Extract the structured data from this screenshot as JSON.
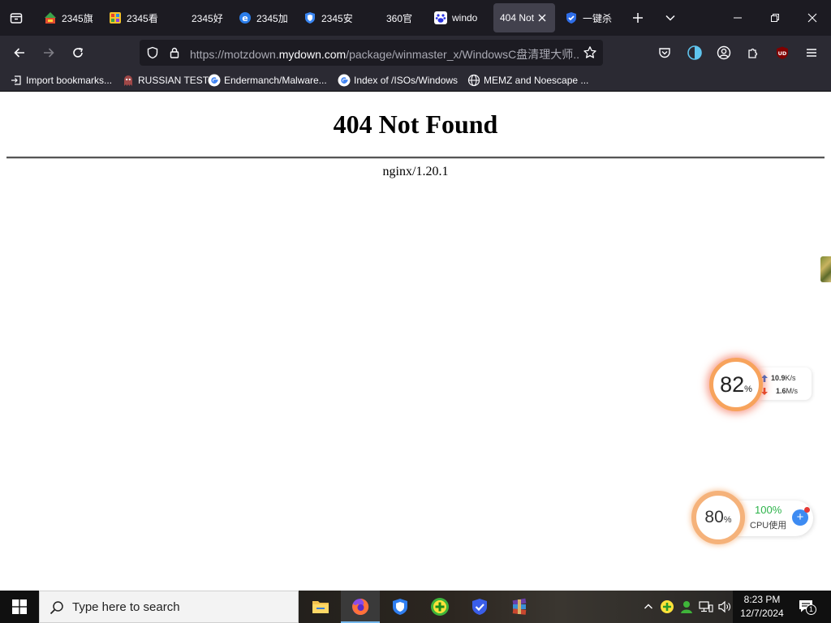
{
  "tabs": [
    {
      "label": "2345旗",
      "icon": "2345-site-icon"
    },
    {
      "label": "2345看",
      "icon": "2345-kan-icon"
    },
    {
      "label": "2345好",
      "icon": ""
    },
    {
      "label": "2345加",
      "icon": "ie-e-icon"
    },
    {
      "label": "2345安",
      "icon": "shield-icon"
    },
    {
      "label": "360官",
      "icon": ""
    },
    {
      "label": "windo",
      "icon": "baidu-paw-icon"
    },
    {
      "label": "404 Not",
      "icon": "",
      "active": true
    },
    {
      "label": "一键杀",
      "icon": "shield-check-icon"
    }
  ],
  "navbar": {
    "url_prefix": "https://motzdown.",
    "url_domain": "mydown.com",
    "url_path": "/package/winmaster_x/WindowsC盘清理大师..."
  },
  "bookmarks": [
    {
      "label": "Import bookmarks...",
      "icon": "import-icon"
    },
    {
      "label": "RUSSIAN TEST",
      "icon": "ghost-icon"
    },
    {
      "label": "Endermanch/Malware...",
      "icon": "google-icon"
    },
    {
      "label": "Index of /ISOs/Windows",
      "icon": "google-icon"
    },
    {
      "label": "MEMZ and Noescape ...",
      "icon": "globe-icon"
    }
  ],
  "page": {
    "title": "404 Not Found",
    "server": "nginx/1.20.1"
  },
  "net_monitor": {
    "percent": "82",
    "percent_unit": "%",
    "upload": "10.9",
    "upload_unit": "K/s",
    "download": "1.6",
    "download_unit": "M/s"
  },
  "cpu_monitor": {
    "percent": "80",
    "percent_unit": "%",
    "cpu_value": "100%",
    "cpu_label": "CPU使用"
  },
  "taskbar": {
    "search_placeholder": "Type here to search",
    "time": "8:23 PM",
    "date": "12/7/2024",
    "notification_count": "1"
  },
  "colors": {
    "tabstrip": "#1c1b22",
    "toolbar": "#2b2a33",
    "active_tab": "#42414d",
    "cpu_green": "#2db34a",
    "ring_orange": "#f7a35c"
  }
}
